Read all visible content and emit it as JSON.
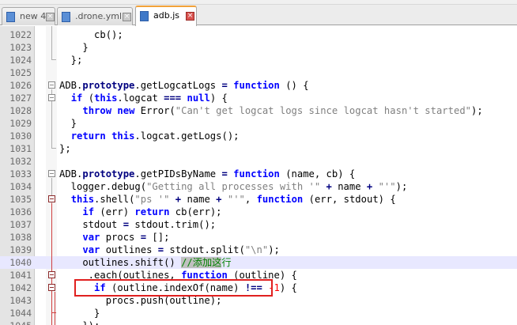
{
  "tabs": [
    {
      "label": "new 4",
      "active": false
    },
    {
      "label": ".drone.yml",
      "active": false
    },
    {
      "label": "adb.js",
      "active": true
    }
  ],
  "lines": [
    {
      "n": "1022",
      "code": [
        [
          "      cb();",
          ""
        ]
      ]
    },
    {
      "n": "1023",
      "code": [
        [
          "    }",
          ""
        ]
      ]
    },
    {
      "n": "1024",
      "code": [
        [
          "  };",
          ""
        ]
      ]
    },
    {
      "n": "1025",
      "code": []
    },
    {
      "n": "1026",
      "code": [
        [
          "ADB.",
          ""
        ],
        [
          "prototype",
          "kw2"
        ],
        [
          ".getLogcatLogs ",
          ""
        ],
        [
          "=",
          "op"
        ],
        [
          " ",
          ""
        ],
        [
          "function",
          "kw"
        ],
        [
          " () {",
          ""
        ]
      ]
    },
    {
      "n": "1027",
      "code": [
        [
          "  ",
          ""
        ],
        [
          "if",
          "kw"
        ],
        [
          " (",
          ""
        ],
        [
          "this",
          "kw"
        ],
        [
          ".logcat ",
          ""
        ],
        [
          "===",
          "op"
        ],
        [
          " ",
          ""
        ],
        [
          "null",
          "kw"
        ],
        [
          ") {",
          ""
        ]
      ]
    },
    {
      "n": "1028",
      "code": [
        [
          "    ",
          ""
        ],
        [
          "throw",
          "kw"
        ],
        [
          " ",
          ""
        ],
        [
          "new",
          "kw"
        ],
        [
          " Error(",
          ""
        ],
        [
          "\"Can't get logcat logs since logcat hasn't started\"",
          "str"
        ],
        [
          ");",
          ""
        ]
      ]
    },
    {
      "n": "1029",
      "code": [
        [
          "  }",
          ""
        ]
      ]
    },
    {
      "n": "1030",
      "code": [
        [
          "  ",
          ""
        ],
        [
          "return",
          "kw"
        ],
        [
          " ",
          ""
        ],
        [
          "this",
          "kw"
        ],
        [
          ".logcat.getLogs();",
          ""
        ]
      ]
    },
    {
      "n": "1031",
      "code": [
        [
          "};",
          ""
        ]
      ]
    },
    {
      "n": "1032",
      "code": []
    },
    {
      "n": "1033",
      "code": [
        [
          "ADB.",
          ""
        ],
        [
          "prototype",
          "kw2"
        ],
        [
          ".getPIDsByName ",
          ""
        ],
        [
          "=",
          "op"
        ],
        [
          " ",
          ""
        ],
        [
          "function",
          "kw"
        ],
        [
          " (name, cb) {",
          ""
        ]
      ]
    },
    {
      "n": "1034",
      "code": [
        [
          "  logger.debug(",
          ""
        ],
        [
          "\"Getting all processes with '\"",
          "str"
        ],
        [
          " ",
          ""
        ],
        [
          "+",
          "op"
        ],
        [
          " name ",
          ""
        ],
        [
          "+",
          "op"
        ],
        [
          " ",
          ""
        ],
        [
          "\"'\"",
          "str"
        ],
        [
          ");",
          ""
        ]
      ]
    },
    {
      "n": "1035",
      "code": [
        [
          "  ",
          ""
        ],
        [
          "this",
          "kw"
        ],
        [
          ".shell(",
          ""
        ],
        [
          "\"ps '\"",
          "str"
        ],
        [
          " ",
          ""
        ],
        [
          "+",
          "op"
        ],
        [
          " name ",
          ""
        ],
        [
          "+",
          "op"
        ],
        [
          " ",
          ""
        ],
        [
          "\"'\"",
          "str"
        ],
        [
          ", ",
          ""
        ],
        [
          "function",
          "kw"
        ],
        [
          " (err, stdout) {",
          ""
        ]
      ]
    },
    {
      "n": "1036",
      "code": [
        [
          "    ",
          ""
        ],
        [
          "if",
          "kw"
        ],
        [
          " (err) ",
          ""
        ],
        [
          "return",
          "kw"
        ],
        [
          " cb(err);",
          ""
        ]
      ]
    },
    {
      "n": "1037",
      "code": [
        [
          "    stdout ",
          ""
        ],
        [
          "=",
          "op"
        ],
        [
          " stdout.trim();",
          ""
        ]
      ]
    },
    {
      "n": "1038",
      "code": [
        [
          "    ",
          ""
        ],
        [
          "var",
          "kw"
        ],
        [
          " procs ",
          ""
        ],
        [
          "=",
          "op"
        ],
        [
          " [];",
          ""
        ]
      ]
    },
    {
      "n": "1039",
      "code": [
        [
          "    ",
          ""
        ],
        [
          "var",
          "kw"
        ],
        [
          " outlines ",
          ""
        ],
        [
          "=",
          "op"
        ],
        [
          " stdout.split(",
          ""
        ],
        [
          "\"\\n\"",
          "str"
        ],
        [
          ");",
          ""
        ]
      ]
    },
    {
      "n": "1040",
      "code": [
        [
          "    outlines.shift() ",
          ""
        ],
        [
          "//添加这",
          "cmt sel"
        ],
        [
          "行",
          "cmt"
        ]
      ]
    },
    {
      "n": "1041",
      "code": [
        [
          "    _.each(outlines, ",
          ""
        ],
        [
          "function",
          "kw"
        ],
        [
          " (outline) {",
          ""
        ]
      ]
    },
    {
      "n": "1042",
      "code": [
        [
          "      ",
          ""
        ],
        [
          "if",
          "kw"
        ],
        [
          " (outline.indexOf(name) ",
          ""
        ],
        [
          "!==",
          "op"
        ],
        [
          " ",
          ""
        ],
        [
          "-1",
          "num"
        ],
        [
          ") {",
          ""
        ]
      ]
    },
    {
      "n": "1043",
      "code": [
        [
          "        procs.push(outline);",
          ""
        ]
      ]
    },
    {
      "n": "1044",
      "code": [
        [
          "      }",
          ""
        ]
      ]
    },
    {
      "n": "1045",
      "code": [
        [
          "    });",
          ""
        ]
      ]
    }
  ],
  "highlighted_line": "1040",
  "colors": {
    "keyword": "#0000ff",
    "string": "#808080",
    "comment": "#008000",
    "annotation_box": "#e0201f",
    "active_tab_accent": "#f2a23a"
  }
}
